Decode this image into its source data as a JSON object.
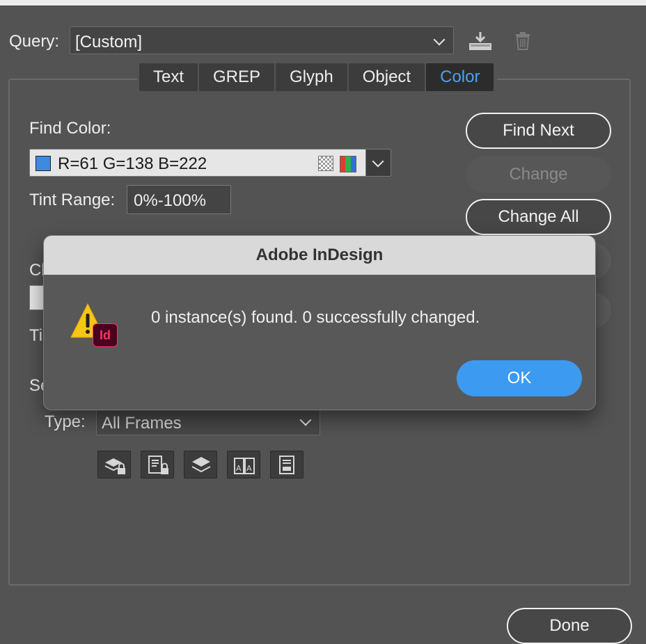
{
  "query": {
    "label": "Query:",
    "value": "[Custom]"
  },
  "tabs": [
    {
      "label": "Text",
      "active": false
    },
    {
      "label": "GREP",
      "active": false
    },
    {
      "label": "Glyph",
      "active": false
    },
    {
      "label": "Object",
      "active": false
    },
    {
      "label": "Color",
      "active": true
    }
  ],
  "find": {
    "label": "Find Color:",
    "value": "R=61 G=138 B=222",
    "swatch_color": "#3d8ade",
    "tint_label": "Tint Range:",
    "tint_value": "0%-100%"
  },
  "change_section": {
    "label_partial": "Cl",
    "tint_partial": "Ti",
    "search_partial": "Se"
  },
  "buttons": {
    "find_next": "Find Next",
    "change": "Change",
    "change_all": "Change All",
    "done": "Done"
  },
  "search_in": {
    "type_label": "Type:",
    "type_value": "All Frames",
    "icons": [
      "locked-layers-icon",
      "locked-stories-icon",
      "hidden-layers-icon",
      "master-pages-icon",
      "footnotes-icon"
    ]
  },
  "alert": {
    "title": "Adobe InDesign",
    "message": "0 instance(s) found. 0 successfully changed.",
    "badge": "Id",
    "ok": "OK"
  },
  "colors": {
    "accent": "#3d9af1",
    "tab_active": "#4ea1f3",
    "dialog_bg": "#535353",
    "warning": "#f5c518",
    "indesign": "#49021f"
  }
}
